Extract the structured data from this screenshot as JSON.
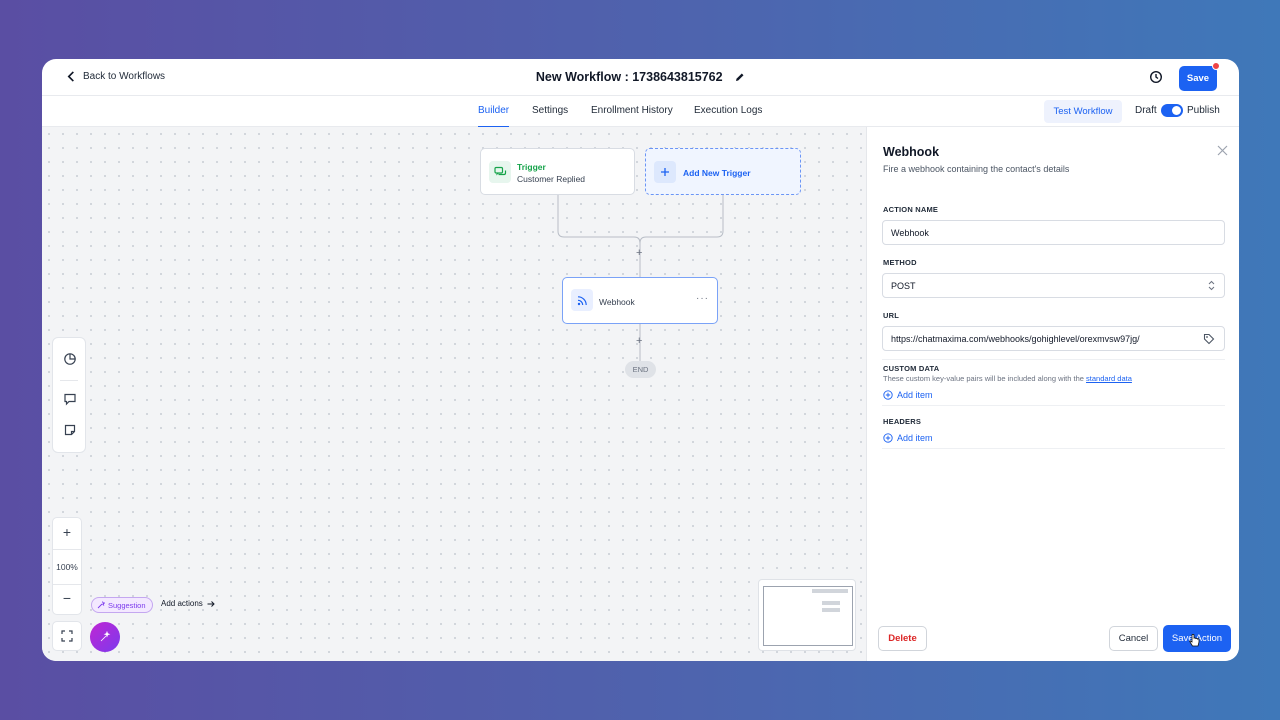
{
  "header": {
    "back_label": "Back to Workflows",
    "title": "New Workflow : 1738643815762",
    "save_label": "Save"
  },
  "tabs": [
    {
      "label": "Builder",
      "active": true
    },
    {
      "label": "Settings",
      "active": false
    },
    {
      "label": "Enrollment History",
      "active": false
    },
    {
      "label": "Execution Logs",
      "active": false
    }
  ],
  "toolbar": {
    "test_label": "Test Workflow",
    "draft_label": "Draft",
    "publish_label": "Publish",
    "published": true
  },
  "canvas": {
    "trigger": {
      "label": "Trigger",
      "subtitle": "Customer Replied"
    },
    "add_trigger_label": "Add New Trigger",
    "action_node": {
      "label": "Webhook",
      "menu": "···"
    },
    "end_label": "END",
    "plus": "+",
    "zoom": {
      "in": "+",
      "level": "100%",
      "out": "−"
    },
    "suggestion_label": "Suggestion",
    "add_actions_label": "Add actions"
  },
  "panel": {
    "title": "Webhook",
    "subtitle": "Fire a webhook containing the contact's details",
    "action_name_label": "ACTION NAME",
    "action_name_value": "Webhook",
    "method_label": "METHOD",
    "method_value": "POST",
    "url_label": "URL",
    "url_value": "https://chatmaxima.com/webhooks/gohighlevel/orexmvsw97jg/",
    "custom_data_label": "CUSTOM DATA",
    "custom_data_note": "These custom key-value pairs will be included along with the",
    "custom_data_link": "standard data",
    "headers_label": "HEADERS",
    "add_item_label": "Add item",
    "delete_label": "Delete",
    "cancel_label": "Cancel",
    "save_action_label": "Save Action"
  },
  "colors": {
    "accent": "#1c62f2",
    "trigger_green": "#16a34a",
    "danger": "#dc2626",
    "suggestion_purple": "#7c3aed"
  }
}
